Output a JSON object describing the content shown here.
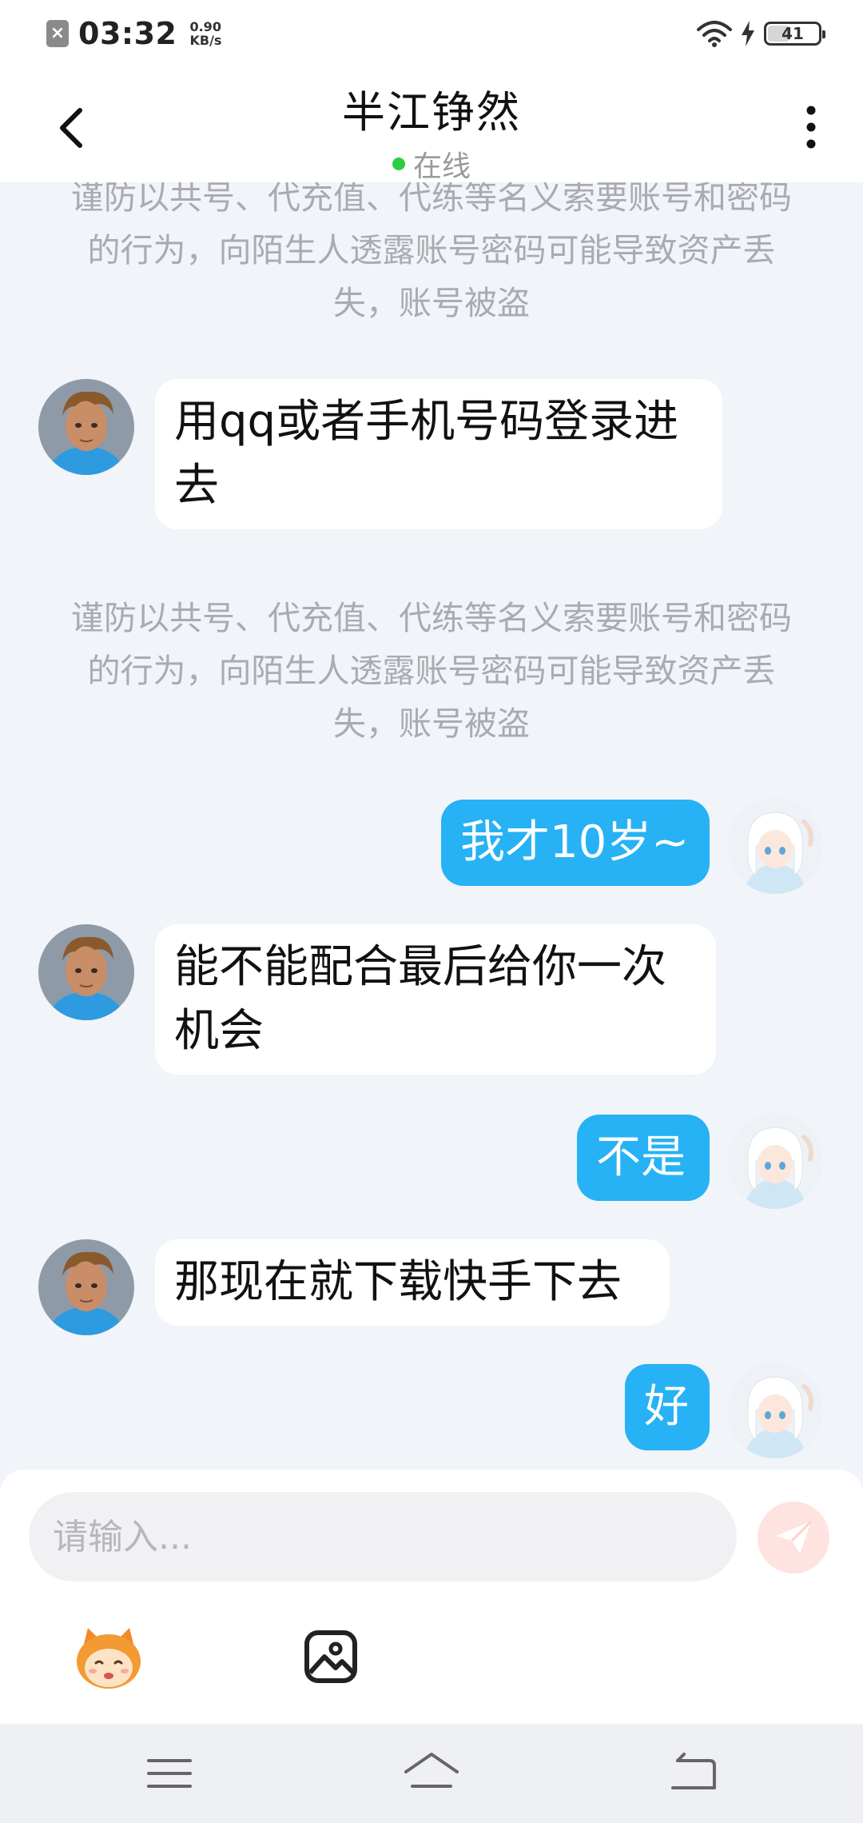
{
  "status_bar": {
    "time": "03:32",
    "speed_value": "0.90",
    "speed_unit": "KB/s",
    "battery": "41"
  },
  "header": {
    "title": "半江铮然",
    "status": "在线"
  },
  "messages": [
    {
      "type": "notice",
      "text": "谨防以共号、代充值、代练等名义索要账号和密码的行为，向陌生人透露账号密码可能导致资产丢失，账号被盗"
    },
    {
      "type": "incoming",
      "text": "用qq或者手机号码登录进去"
    },
    {
      "type": "notice",
      "text": "谨防以共号、代充值、代练等名义索要账号和密码的行为，向陌生人透露账号密码可能导致资产丢失，账号被盗"
    },
    {
      "type": "outgoing",
      "text": "我才10岁~"
    },
    {
      "type": "incoming",
      "text": "能不能配合最后给你一次机会"
    },
    {
      "type": "outgoing",
      "text": "不是"
    },
    {
      "type": "incoming",
      "text": "那现在就下载快手下去"
    },
    {
      "type": "outgoing",
      "text": "好"
    }
  ],
  "input": {
    "placeholder": "请输入..."
  },
  "icons": {
    "back": "back-arrow-icon",
    "more": "more-vertical-icon",
    "send": "send-icon",
    "emoji": "emoji-mascot-icon",
    "image": "image-icon",
    "nav_menu": "menu-icon",
    "nav_home": "home-icon",
    "nav_back": "back-nav-icon"
  },
  "colors": {
    "outgoing_bubble": "#26b2f4",
    "incoming_bubble": "#ffffff",
    "chat_background": "#f1f4f8",
    "online": "#2ecc40",
    "send_button": "#ffe3e0"
  }
}
